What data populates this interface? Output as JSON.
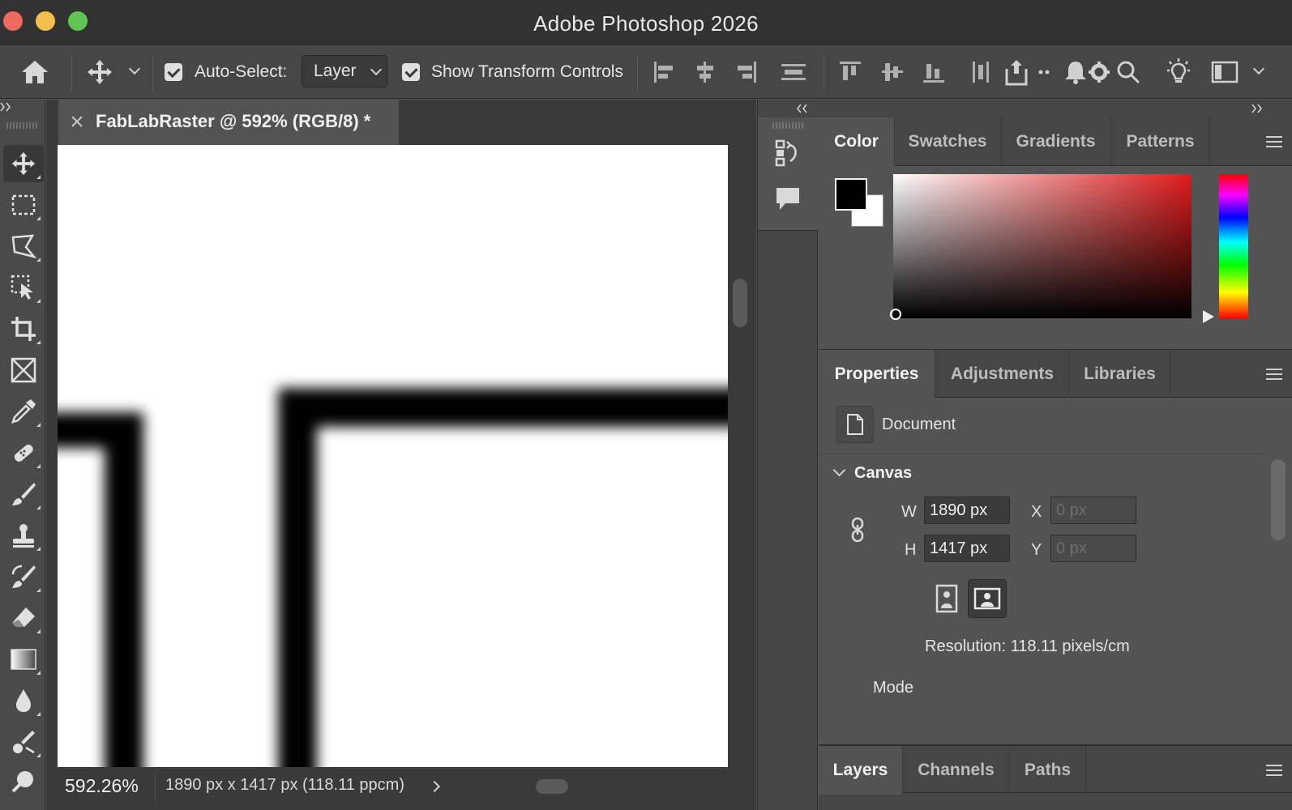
{
  "window": {
    "title": "Adobe Photoshop 2026"
  },
  "options_bar": {
    "auto_select_label": "Auto-Select:",
    "auto_select_checked": true,
    "auto_select_target": "Layer",
    "show_transform_label": "Show Transform Controls",
    "show_transform_checked": true
  },
  "tools": [
    "move-tool",
    "rectangular-marquee-tool",
    "lasso-tool",
    "object-selection-tool",
    "crop-tool",
    "frame-tool",
    "eyedropper-tool",
    "spot-healing-brush-tool",
    "brush-tool",
    "clone-stamp-tool",
    "history-brush-tool",
    "eraser-tool",
    "gradient-tool",
    "blur-tool",
    "dodge-tool",
    "pen-tool"
  ],
  "document": {
    "tab_title": "FabLabRaster @ 592% (RGB/8) *",
    "zoom": "592.26%",
    "info": "1890 px x 1417 px (118.11 ppcm)"
  },
  "color_panel": {
    "tabs": [
      "Color",
      "Swatches",
      "Gradients",
      "Patterns"
    ],
    "active_tab": "Color",
    "foreground": "#000000",
    "background": "#ffffff"
  },
  "properties_panel": {
    "tabs": [
      "Properties",
      "Adjustments",
      "Libraries"
    ],
    "active_tab": "Properties",
    "document_label": "Document",
    "canvas_section": "Canvas",
    "w_label": "W",
    "w_value": "1890 px",
    "h_label": "H",
    "h_value": "1417 px",
    "x_label": "X",
    "x_value": "0 px",
    "y_label": "Y",
    "y_value": "0 px",
    "resolution": "Resolution: 118.11 pixels/cm",
    "mode_label": "Mode"
  },
  "layers_panel": {
    "tabs": [
      "Layers",
      "Channels",
      "Paths"
    ],
    "active_tab": "Layers"
  }
}
